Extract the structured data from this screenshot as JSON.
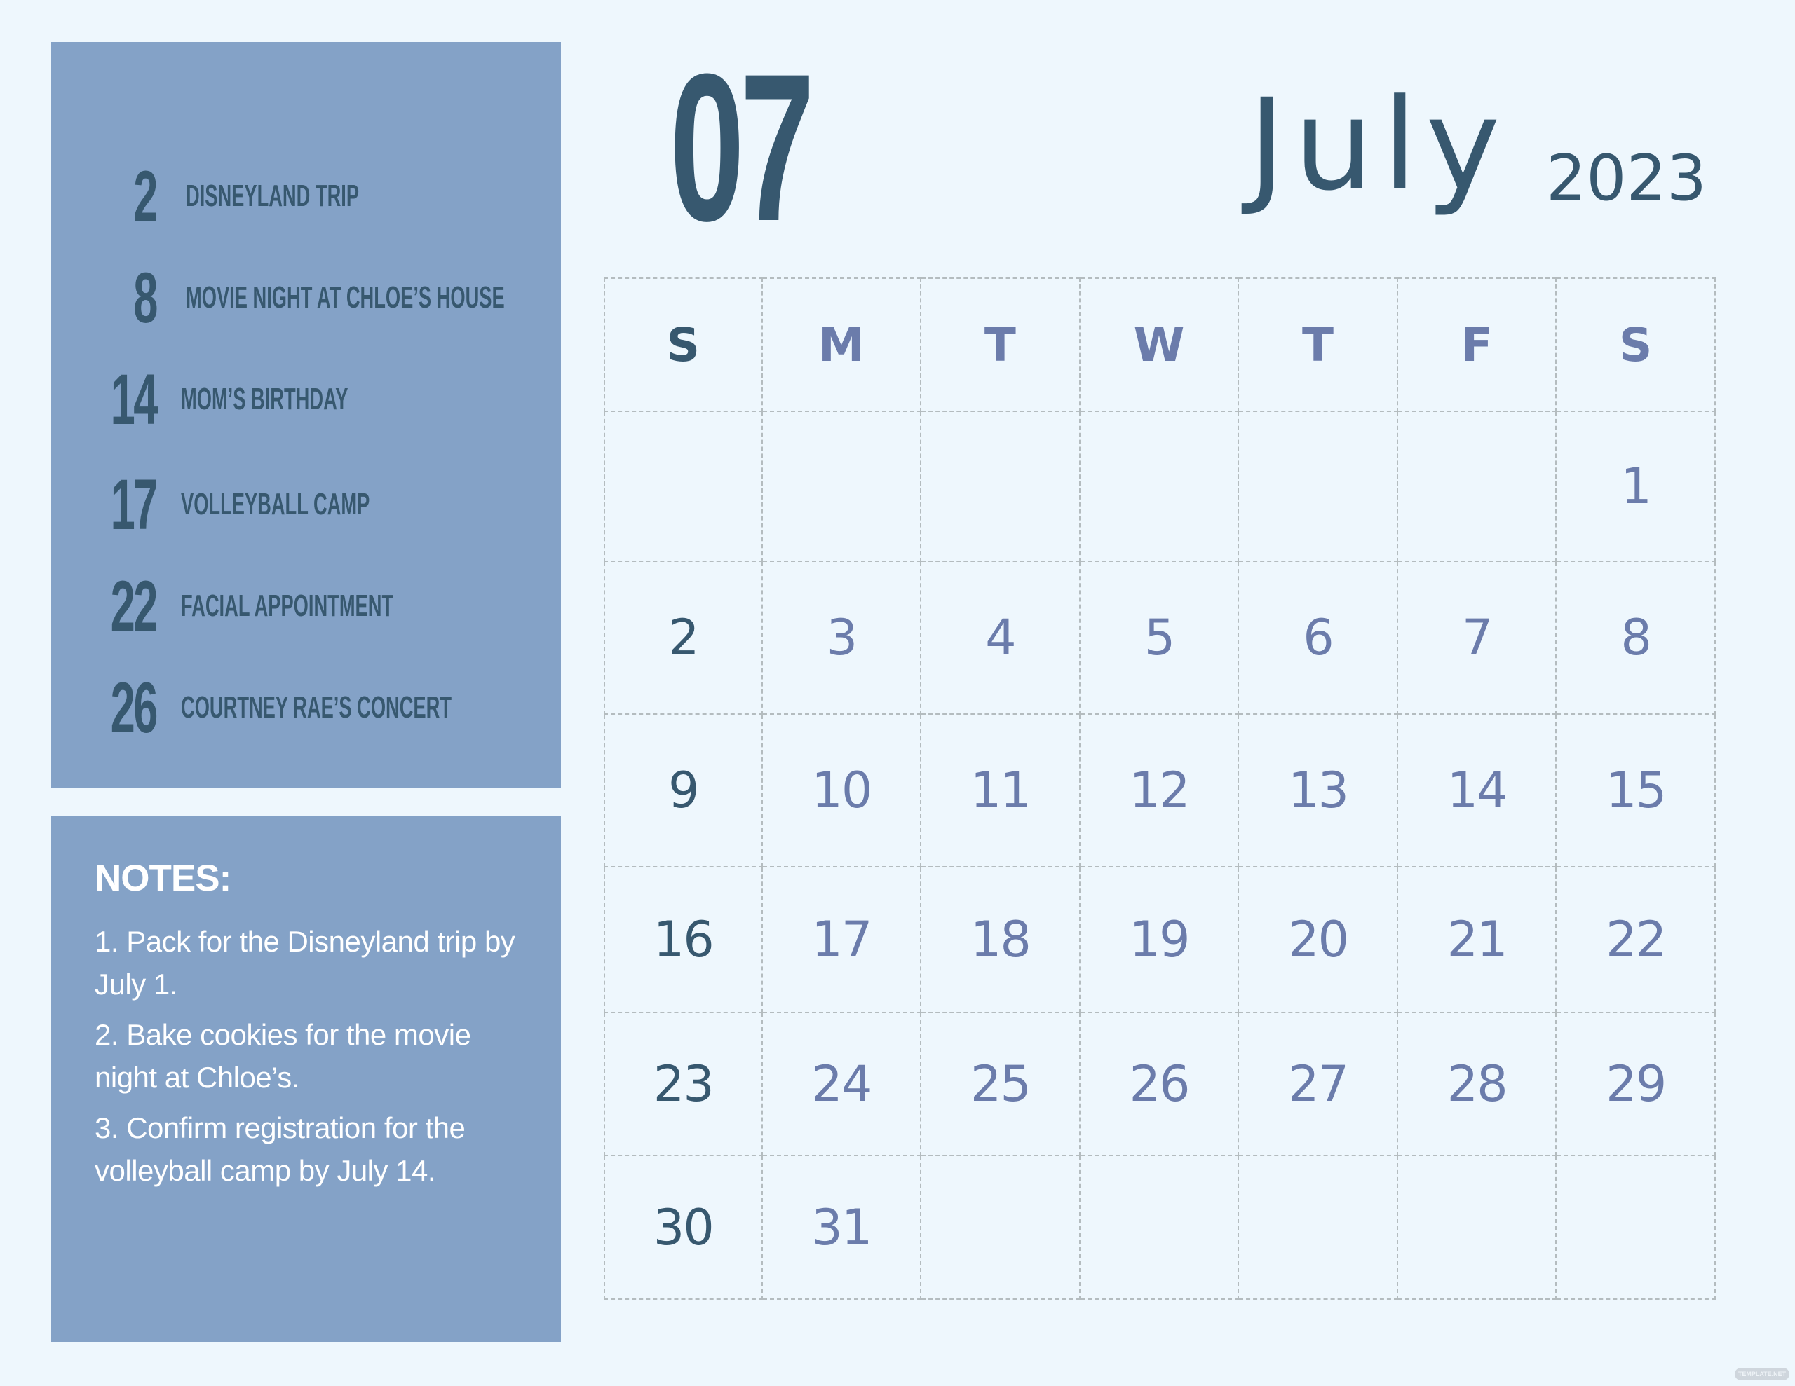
{
  "colors": {
    "background": "#eef7fd",
    "panel": "#84a2c7",
    "primary_dark": "#37586f",
    "weekday_accent": "#6b7cab",
    "grid_line": "#b4bcbf",
    "notes_text": "#ffffff"
  },
  "header": {
    "month_number": "07",
    "month_name": "July",
    "year": "2023"
  },
  "events": [
    {
      "day": "2",
      "title": "DISNEYLAND TRIP"
    },
    {
      "day": "8",
      "title": "MOVIE NIGHT AT CHLOE’S HOUSE"
    },
    {
      "day": "14",
      "title": "MOM’S BIRTHDAY"
    },
    {
      "day": "17",
      "title": "VOLLEYBALL CAMP"
    },
    {
      "day": "22",
      "title": "FACIAL APPOINTMENT"
    },
    {
      "day": "26",
      "title": "COURTNEY RAE’S CONCERT"
    }
  ],
  "notes": {
    "title": "NOTES:",
    "items": [
      "1. Pack for the Disneyland trip by July 1.",
      "2. Bake cookies for the movie night at Chloe’s.",
      "3. Confirm registration for the volleyball camp by July 14."
    ]
  },
  "calendar": {
    "weekdays": [
      "S",
      "M",
      "T",
      "W",
      "T",
      "F",
      "S"
    ],
    "weeks": [
      [
        "",
        "",
        "",
        "",
        "",
        "",
        "1"
      ],
      [
        "2",
        "3",
        "4",
        "5",
        "6",
        "7",
        "8"
      ],
      [
        "9",
        "10",
        "11",
        "12",
        "13",
        "14",
        "15"
      ],
      [
        "16",
        "17",
        "18",
        "19",
        "20",
        "21",
        "22"
      ],
      [
        "23",
        "24",
        "25",
        "26",
        "27",
        "28",
        "29"
      ],
      [
        "30",
        "31",
        "",
        "",
        "",
        "",
        ""
      ]
    ]
  },
  "watermark": "TEMPLATE.NET"
}
